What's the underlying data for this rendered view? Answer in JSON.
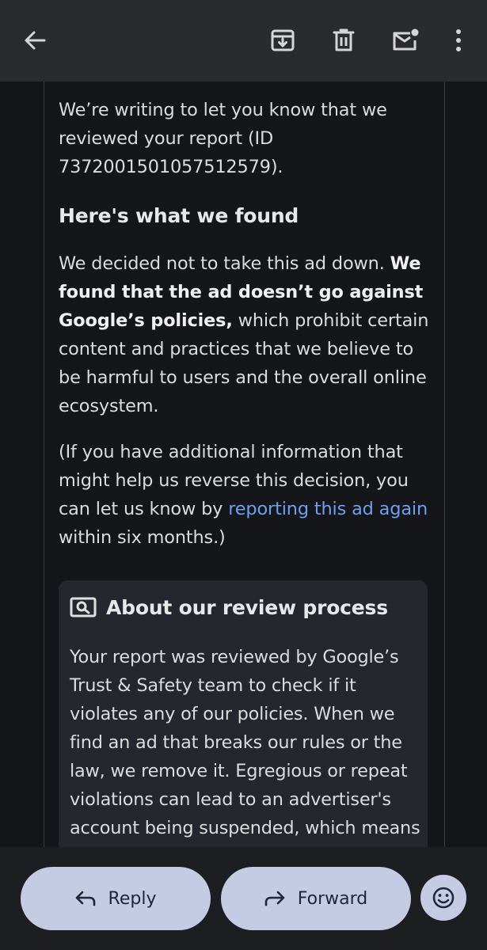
{
  "toolbar": {
    "back_icon": "arrow-left-icon",
    "archive_icon": "archive-icon",
    "delete_icon": "trash-icon",
    "mark_unread_icon": "mail-unread-icon",
    "more_icon": "more-vert-icon"
  },
  "email": {
    "intro": "We’re writing to let you know that we reviewed your report (ID 7372001501057512579).",
    "heading": "Here's what we found",
    "finding_start": "We decided not to take this ad down. ",
    "finding_bold": "We found that the ad doesn’t go against Google’s policies,",
    "finding_end": " which prohibit certain content and practices that we believe to be harmful to users and the overall online ecosystem.",
    "followup_start": "(If you have additional information that might help us reverse this decision, you can let us know by ",
    "followup_link": "reporting this ad again",
    "followup_end": " within six months.)",
    "card": {
      "icon": "search-document-icon",
      "title": "About our review process",
      "body": "Your report was reviewed by Google’s Trust & Safety team to check if it violates any of our policies. When we find an ad that breaks our rules or the law, we remove it. Egregious or repeat violations can lead to an advertiser's account being suspended, which means they can no"
    }
  },
  "actions": {
    "reply_label": "Reply",
    "forward_label": "Forward",
    "emoji_icon": "emoji-icon"
  },
  "colors": {
    "link": "#6f9ff0",
    "pill": "#c5cbe3",
    "topbar": "#2a2b2f"
  }
}
